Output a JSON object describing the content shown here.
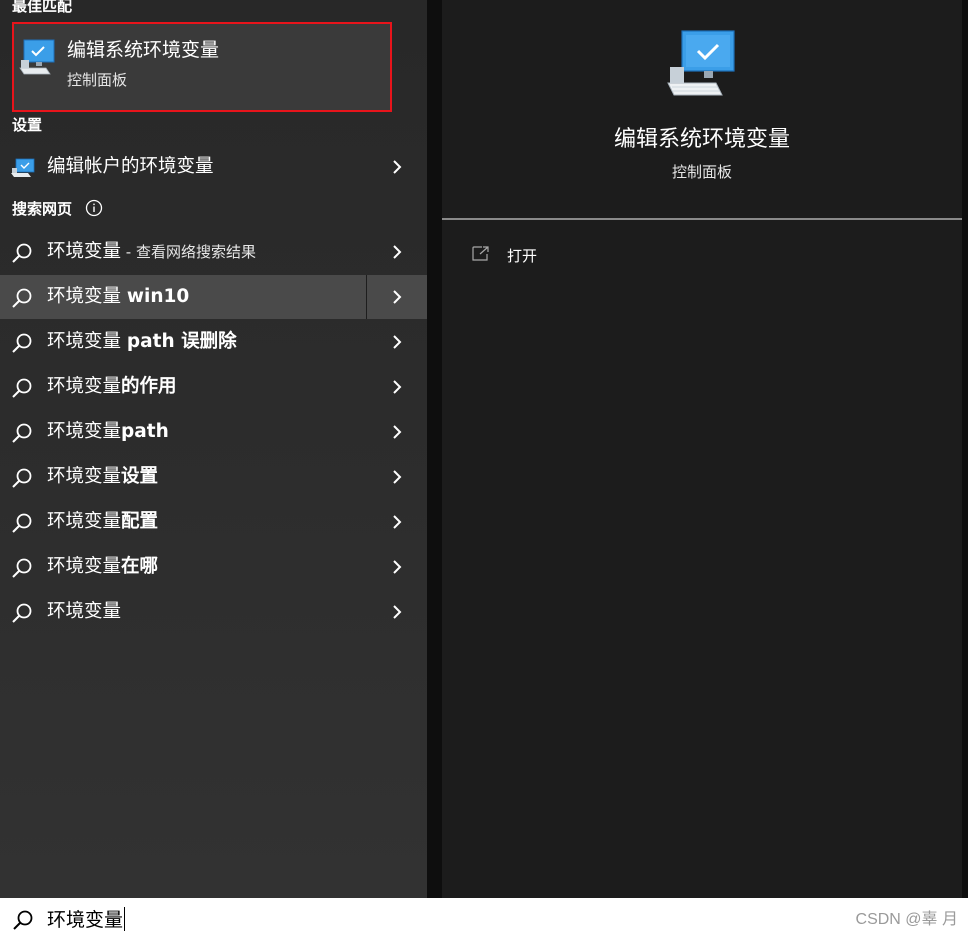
{
  "sections": {
    "best_match": "最佳匹配",
    "settings": "设置",
    "web": "搜索网页"
  },
  "best_match": {
    "title": "编辑系统环境变量",
    "subtitle": "控制面板",
    "icon": "computer-icon"
  },
  "settings_item": {
    "label": "编辑帐户的环境变量",
    "icon": "computer-icon"
  },
  "web_results": [
    {
      "normal": "环境变量",
      "bold": "",
      "hint": " - 查看网络搜索结果"
    },
    {
      "normal": "环境变量 ",
      "bold": "win10",
      "hint": ""
    },
    {
      "normal": "环境变量 ",
      "bold": "path 误删除",
      "hint": ""
    },
    {
      "normal": "环境变量",
      "bold": "的作用",
      "hint": ""
    },
    {
      "normal": "环境变量",
      "bold": "path",
      "hint": ""
    },
    {
      "normal": "环境变量",
      "bold": "设置",
      "hint": ""
    },
    {
      "normal": "环境变量",
      "bold": "配置",
      "hint": ""
    },
    {
      "normal": "环境变量",
      "bold": "在哪",
      "hint": ""
    },
    {
      "normal": "环境变量",
      "bold": "",
      "hint": ""
    }
  ],
  "selected_web_index": 1,
  "preview": {
    "title": "编辑系统环境变量",
    "subtitle": "控制面板",
    "open_label": "打开"
  },
  "search": {
    "query": "环境变量"
  },
  "watermark": "CSDN @辜 月",
  "colors": {
    "highlight_border": "#e8141b",
    "icon_blue": "#3b9ee8"
  }
}
